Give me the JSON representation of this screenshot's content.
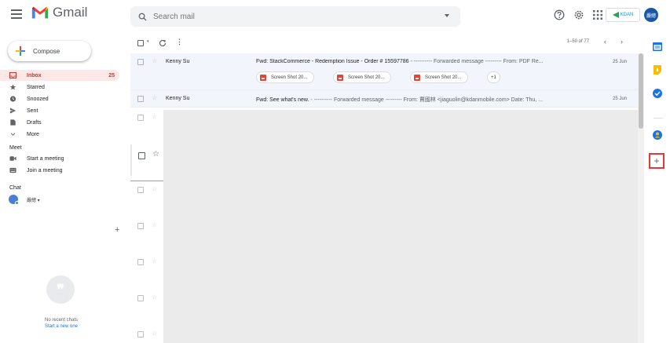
{
  "header": {
    "app_name": "Gmail",
    "search_placeholder": "Search mail",
    "kdan_label": "KDAN",
    "avatar_text": "嚴總"
  },
  "sidebar": {
    "compose_label": "Compose",
    "items": [
      {
        "label": "Inbox",
        "count": "25",
        "active": true,
        "icon": "inbox-icon"
      },
      {
        "label": "Starred",
        "count": "",
        "icon": "star-icon"
      },
      {
        "label": "Snoozed",
        "count": "",
        "icon": "clock-icon"
      },
      {
        "label": "Sent",
        "count": "",
        "icon": "send-icon"
      },
      {
        "label": "Drafts",
        "count": "",
        "icon": "draft-icon"
      },
      {
        "label": "More",
        "count": "",
        "icon": "chevron-down-icon"
      }
    ],
    "meet": {
      "title": "Meet",
      "start": "Start a meeting",
      "join": "Join a meeting"
    },
    "chat": {
      "title": "Chat",
      "user": "嚴總 ▾",
      "no_recent": "No recent chats",
      "start_new": "Start a new one"
    }
  },
  "toolbar": {
    "paging": "1–50 of 77"
  },
  "emails": [
    {
      "sender": "Kenny Su",
      "subject": "Fwd: StackCommerce - Redemption Issue - Order # 15597786",
      "snippet": " - ---------- Forwarded message --------- From: PDF Re...",
      "date": "25 Jun",
      "attachments": [
        "Screen Shot 20...",
        "Screen Shot 20...",
        "Screen Shot 20..."
      ],
      "more_attachments": "+1"
    },
    {
      "sender": "Kenny Su",
      "subject": "Fwd: See what's new.",
      "snippet": " - ---------- Forwarded message --------- From: 賈國林 <jiaguolin@kdanmobile.com> Date: Thu, ...",
      "date": "25 Jun"
    }
  ],
  "colors": {
    "accent_red": "#d93025",
    "inbox_bg": "#fce8e6",
    "read_row_bg": "#f2f6fc",
    "overlay_gray": "#ebebeb",
    "highlight_box": "#e53935"
  }
}
